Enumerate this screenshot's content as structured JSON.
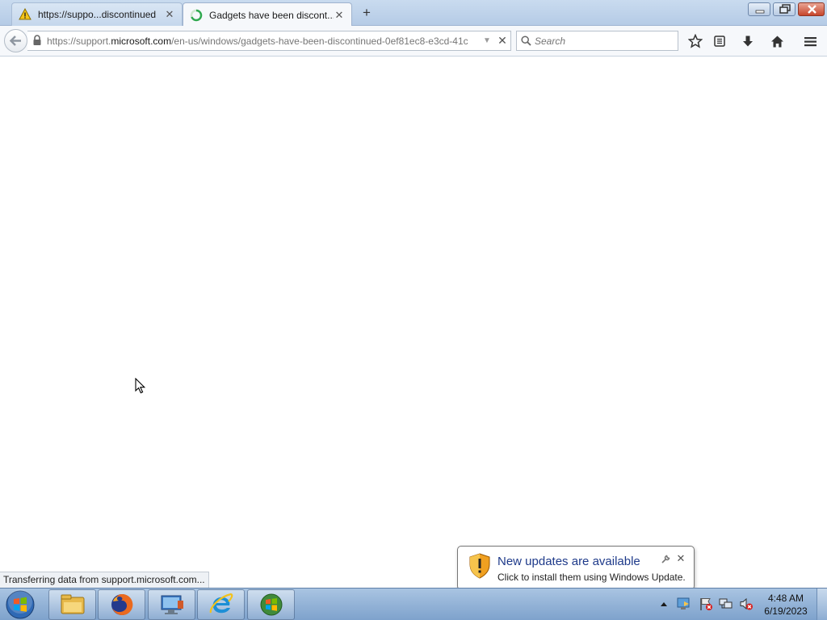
{
  "browser": {
    "tabs": [
      {
        "label": "https://suppo...discontinued",
        "icon": "warning-icon",
        "active": false
      },
      {
        "label": "Gadgets have been discont...",
        "icon": "loading-spinner-icon",
        "active": true
      }
    ],
    "new_tab_icon": "plus-icon",
    "url": {
      "prefix": "https://support.",
      "domain": "microsoft.com",
      "path": "/en-us/windows/gadgets-have-been-discontinued-0ef81ec8-e3cd-41c"
    },
    "search_placeholder": "Search",
    "toolbar_icons": [
      "star-icon",
      "reading-list-icon",
      "download-icon",
      "home-icon",
      "menu-icon"
    ],
    "status_text": "Transferring data from support.microsoft.com..."
  },
  "notification": {
    "title": "New updates are available",
    "message": "Click to install them using Windows Update.",
    "icon": "shield-warning-icon"
  },
  "taskbar": {
    "pinned": [
      "explorer-icon",
      "firefox-icon",
      "remote-desktop-icon",
      "internet-explorer-icon",
      "windows-update-icon"
    ],
    "clock_time": "4:48 AM",
    "clock_date": "6/19/2023"
  },
  "colors": {
    "accent": "#1e3a8a",
    "tab_strip": "#b5cbe6",
    "taskbar": "#7ea2cc"
  }
}
